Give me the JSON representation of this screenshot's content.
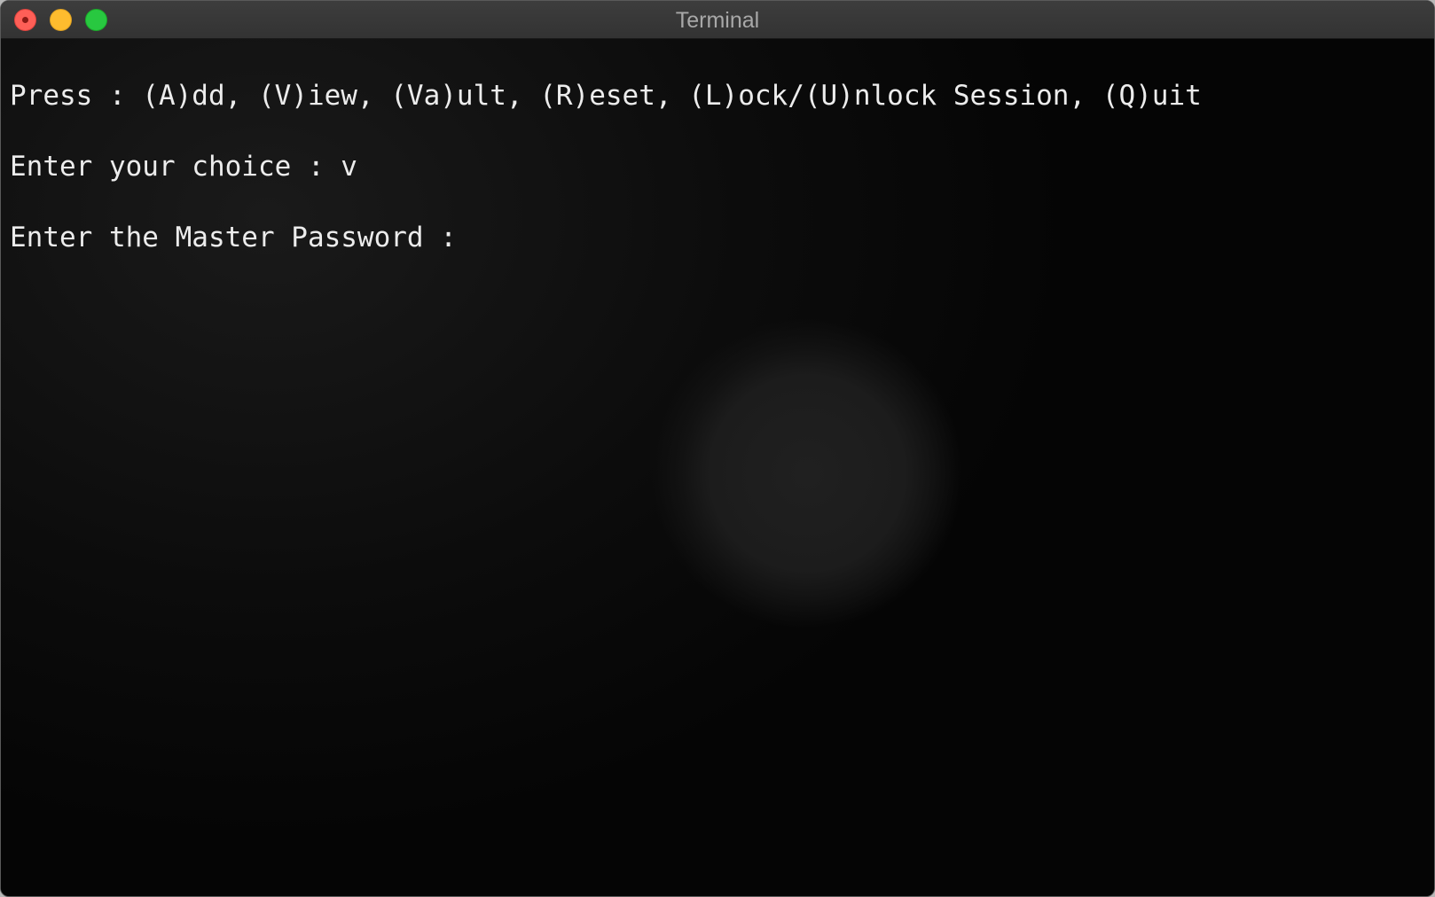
{
  "window": {
    "title": "Terminal"
  },
  "terminal": {
    "lines": [
      "Press : (A)dd, (V)iew, (Va)ult, (R)eset, (L)ock/(U)nlock Session, (Q)uit",
      "Enter your choice : v",
      "Enter the Master Password : "
    ]
  },
  "colors": {
    "background": "#000000",
    "text": "#ececec",
    "titlebar": "#383838",
    "close": "#fe5f57",
    "minimize": "#febc2e",
    "maximize": "#28c840"
  }
}
